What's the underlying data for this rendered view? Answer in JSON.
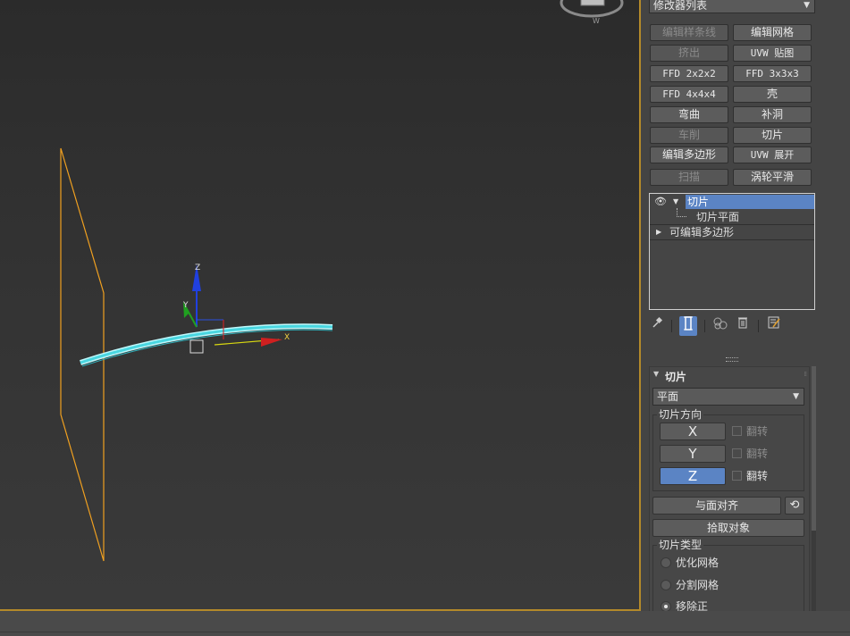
{
  "modifier_list": {
    "label": "修改器列表"
  },
  "modifier_buttons": [
    {
      "label": "编辑样条线",
      "enabled": false
    },
    {
      "label": "编辑网格",
      "enabled": true
    },
    {
      "label": "挤出",
      "enabled": false
    },
    {
      "label": "UVW 贴图",
      "enabled": true
    },
    {
      "label": "FFD 2x2x2",
      "enabled": true
    },
    {
      "label": "FFD 3x3x3",
      "enabled": true
    },
    {
      "label": "FFD 4x4x4",
      "enabled": true
    },
    {
      "label": "壳",
      "enabled": true
    },
    {
      "label": "弯曲",
      "enabled": true
    },
    {
      "label": "补洞",
      "enabled": true
    },
    {
      "label": "车削",
      "enabled": false
    },
    {
      "label": "切片",
      "enabled": true
    },
    {
      "label": "编辑多边形",
      "enabled": true
    },
    {
      "label": "UVW 展开",
      "enabled": true
    },
    {
      "label": "扫描",
      "enabled": false
    },
    {
      "label": "涡轮平滑",
      "enabled": true
    }
  ],
  "stack": {
    "items": [
      {
        "label": "切片",
        "selected": true
      },
      {
        "label": "切片平面"
      },
      {
        "label": "可编辑多边形"
      }
    ]
  },
  "stack_toolbar": {
    "icons": [
      "pin-icon",
      "show-end-result-icon",
      "make-unique-icon",
      "remove-modifier-icon",
      "configure-sets-icon"
    ]
  },
  "rollout": {
    "title": "切片",
    "plane_dropdown": "平面",
    "direction_group": "切片方向",
    "axes": [
      {
        "label": "X",
        "active": false,
        "flip": "翻转"
      },
      {
        "label": "Y",
        "active": false,
        "flip": "翻转"
      },
      {
        "label": "Z",
        "active": true,
        "flip": "翻转"
      }
    ],
    "align_to_face": "与面对齐",
    "pick_object": "拾取对象",
    "slice_type_group": "切片类型",
    "slice_types": [
      {
        "label": "优化网格",
        "selected": false
      },
      {
        "label": "分割网格",
        "selected": false
      },
      {
        "label": "移除正",
        "selected": true
      }
    ]
  },
  "viewport": {
    "gizmo_labels": {
      "x": "X",
      "y": "Y",
      "z": "Z"
    },
    "colors": {
      "plane": "#f0a020",
      "curve": "#7fe8ee",
      "x_axis": "#e02020",
      "y_axis": "#20a020",
      "z_axis": "#2040e0",
      "panel_accent": "#5b84c4"
    }
  }
}
